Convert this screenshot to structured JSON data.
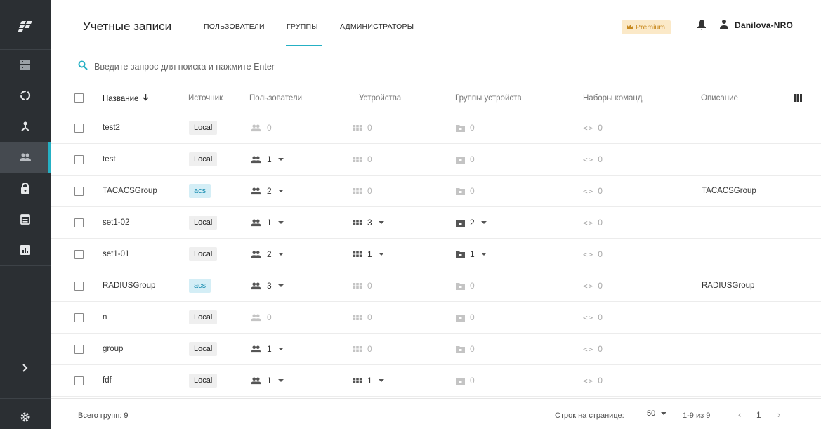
{
  "header": {
    "title": "Учетные записи",
    "tabs": [
      {
        "label": "ПОЛЬЗОВАТЕЛИ"
      },
      {
        "label": "ГРУППЫ"
      },
      {
        "label": "АДМИНИСТРАТОРЫ"
      }
    ],
    "active_tab": "ГРУППЫ",
    "premium_label": "Premium",
    "user_name": "Danilova-NRO"
  },
  "sidebar": {
    "items": [
      {
        "icon": "logo-icon"
      },
      {
        "icon": "servers-icon"
      },
      {
        "icon": "sessions-icon"
      },
      {
        "icon": "network-icon"
      },
      {
        "icon": "groups-icon",
        "active": true
      },
      {
        "icon": "lock-icon"
      },
      {
        "icon": "calendar-icon"
      },
      {
        "icon": "reports-icon"
      },
      {
        "icon": "expand-icon"
      },
      {
        "icon": "settings-icon"
      }
    ]
  },
  "search": {
    "placeholder": "Введите запрос для поиска и нажмите Enter"
  },
  "table": {
    "columns": [
      "Название",
      "Источник",
      "Пользователи",
      "Устройства",
      "Группы устройств",
      "Наборы команд",
      "Описание"
    ],
    "sort_column": "Название",
    "sort_direction": "desc",
    "rows": [
      {
        "name": "test2",
        "source": "Local",
        "users": "0",
        "devices": "0",
        "device_groups": "0",
        "command_sets": "0",
        "description": ""
      },
      {
        "name": "test",
        "source": "Local",
        "users": "1",
        "devices": "0",
        "device_groups": "0",
        "command_sets": "0",
        "description": ""
      },
      {
        "name": "TACACSGroup",
        "source": "acs",
        "users": "2",
        "devices": "0",
        "device_groups": "0",
        "command_sets": "0",
        "description": "TACACSGroup"
      },
      {
        "name": "set1-02",
        "source": "Local",
        "users": "1",
        "devices": "3",
        "device_groups": "2",
        "command_sets": "0",
        "description": ""
      },
      {
        "name": "set1-01",
        "source": "Local",
        "users": "2",
        "devices": "1",
        "device_groups": "1",
        "command_sets": "0",
        "description": ""
      },
      {
        "name": "RADIUSGroup",
        "source": "acs",
        "users": "3",
        "devices": "0",
        "device_groups": "0",
        "command_sets": "0",
        "description": "RADIUSGroup"
      },
      {
        "name": "n",
        "source": "Local",
        "users": "0",
        "devices": "0",
        "device_groups": "0",
        "command_sets": "0",
        "description": ""
      },
      {
        "name": "group",
        "source": "Local",
        "users": "1",
        "devices": "0",
        "device_groups": "0",
        "command_sets": "0",
        "description": ""
      },
      {
        "name": "fdf",
        "source": "Local",
        "users": "1",
        "devices": "1",
        "device_groups": "0",
        "command_sets": "0",
        "description": ""
      }
    ]
  },
  "footer": {
    "total": "Всего групп: 9",
    "rows_per_page_label": "Строк на странице:",
    "rows_per_page": "50",
    "range": "1-9 из 9",
    "page": "1"
  },
  "colors": {
    "sidebar_bg": "#2b2f33",
    "accent": "#25b0c4",
    "premium_bg": "#fbe9c8",
    "premium_text": "#c88a20",
    "acs_bg": "#d4eef6",
    "acs_text": "#1c8fb2",
    "local_bg": "#efefef"
  }
}
